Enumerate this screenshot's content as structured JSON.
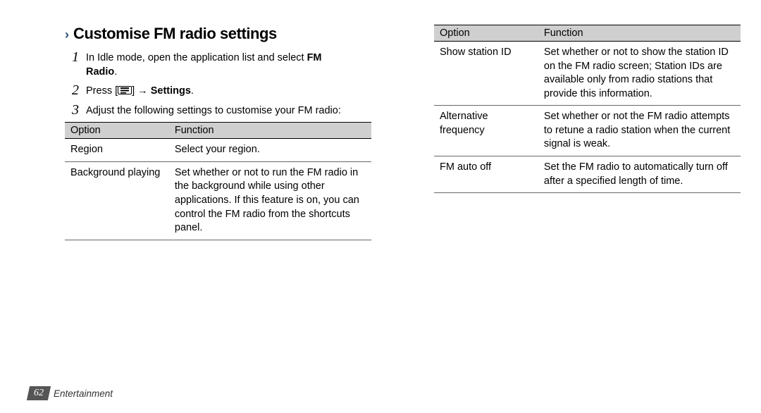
{
  "heading": "Customise FM radio settings",
  "steps": {
    "s1_a": "In Idle mode, open the application list and select ",
    "s1_b1": "FM",
    "s1_b2": "Radio",
    "s1_c": ".",
    "s2_a": "Press [",
    "s2_b": "] → ",
    "s2_bold": "Settings",
    "s2_c": ".",
    "s3": "Adjust the following settings to customise your FM radio:"
  },
  "table_headers": {
    "option": "Option",
    "function": "Function"
  },
  "left_rows": [
    {
      "option": "Region",
      "function": "Select your region."
    },
    {
      "option": "Background playing",
      "function": "Set whether or not to run the FM radio in the background while using other applications. If this feature is on, you can control the FM radio from the shortcuts panel."
    }
  ],
  "right_rows": [
    {
      "option": "Show station ID",
      "function": "Set whether or not to show the station ID on the FM radio screen; Station IDs are available only from radio stations that provide this information."
    },
    {
      "option": "Alternative frequency",
      "function": "Set whether or not the FM radio attempts to retune a radio station when the current signal is weak."
    },
    {
      "option": "FM auto off",
      "function": "Set the FM radio to automatically turn off after a specified length of time."
    }
  ],
  "footer": {
    "page": "62",
    "section": "Entertainment"
  }
}
